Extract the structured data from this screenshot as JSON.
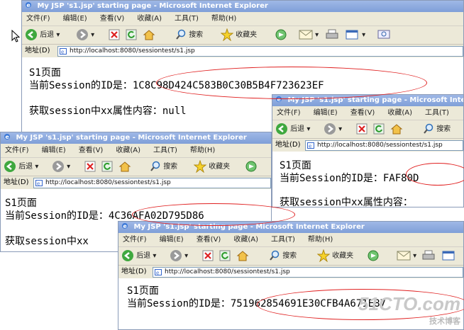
{
  "windows": [
    {
      "title": "My JSP 's1.jsp' starting page - Microsoft Internet Explorer",
      "menu": [
        "文件(F)",
        "编辑(E)",
        "查看(V)",
        "收藏(A)",
        "工具(T)",
        "帮助(H)"
      ],
      "toolbar": {
        "back": "后退",
        "search": "搜索",
        "favorites": "收藏夹"
      },
      "address_label": "地址(D)",
      "url": "http://localhost:8080/sessiontest/s1.jsp",
      "page": {
        "heading": "S1页面",
        "session_label": "当前Session的ID是：",
        "session_id": "1C8C98D424C583B0C30B5B4F723623EF",
        "attr_line": "获取session中xx属性内容：null"
      }
    },
    {
      "title": "My JSP 's1.jsp' starting page - Microsoft Internet",
      "menu": [
        "文件(F)",
        "编辑(E)",
        "查看(V)",
        "收藏(A)",
        "工具(T)"
      ],
      "toolbar": {
        "back": "后退",
        "search": "搜索"
      },
      "address_label": "地址(D)",
      "url": "http://localhost:8080/sessiontest/s1.jsp",
      "page": {
        "heading": "S1页面",
        "session_label": "当前Session的ID是：",
        "session_id": "FAF80D",
        "attr_line": "获取session中xx属性内容："
      }
    },
    {
      "title": "My JSP 's1.jsp' starting page - Microsoft Internet Explorer",
      "menu": [
        "文件(F)",
        "编辑(E)",
        "查看(V)",
        "收藏(A)",
        "工具(T)",
        "帮助(H)"
      ],
      "toolbar": {
        "back": "后退",
        "search": "搜索",
        "favorites": "收藏夹"
      },
      "address_label": "地址(D)",
      "url": "http://localhost:8080/sessiontest/s1.jsp",
      "page": {
        "heading": "S1页面",
        "session_label": "当前Session的ID是：",
        "session_id": "4C36AFA02D795D86",
        "attr_line": "获取session中xx"
      }
    },
    {
      "title": "My JSP 's1.jsp' starting page - Microsoft Internet Explorer",
      "menu": [
        "文件(F)",
        "编辑(E)",
        "查看(V)",
        "收藏(A)",
        "工具(T)",
        "帮助(H)"
      ],
      "toolbar": {
        "back": "后退",
        "search": "搜索",
        "favorites": "收藏夹"
      },
      "address_label": "地址(D)",
      "url": "http://localhost:8080/sessiontest/s1.jsp",
      "page": {
        "heading": "S1页面",
        "session_label": "当前Session的ID是：",
        "session_id": "751962854691E30CFB4A671E87"
      }
    }
  ],
  "watermark": {
    "brand": "51CTO.com",
    "sub": "技术博客"
  },
  "colors": {
    "titlebar": "#7f9fd8",
    "chrome": "#ece9d8",
    "annotation": "#e02020"
  },
  "icons": [
    "back-arrow-icon",
    "forward-arrow-icon",
    "stop-icon",
    "refresh-icon",
    "home-icon",
    "search-icon",
    "favorites-star-icon",
    "media-icon",
    "mail-icon",
    "print-icon",
    "edit-icon",
    "ie-page-icon",
    "cursor-icon"
  ]
}
